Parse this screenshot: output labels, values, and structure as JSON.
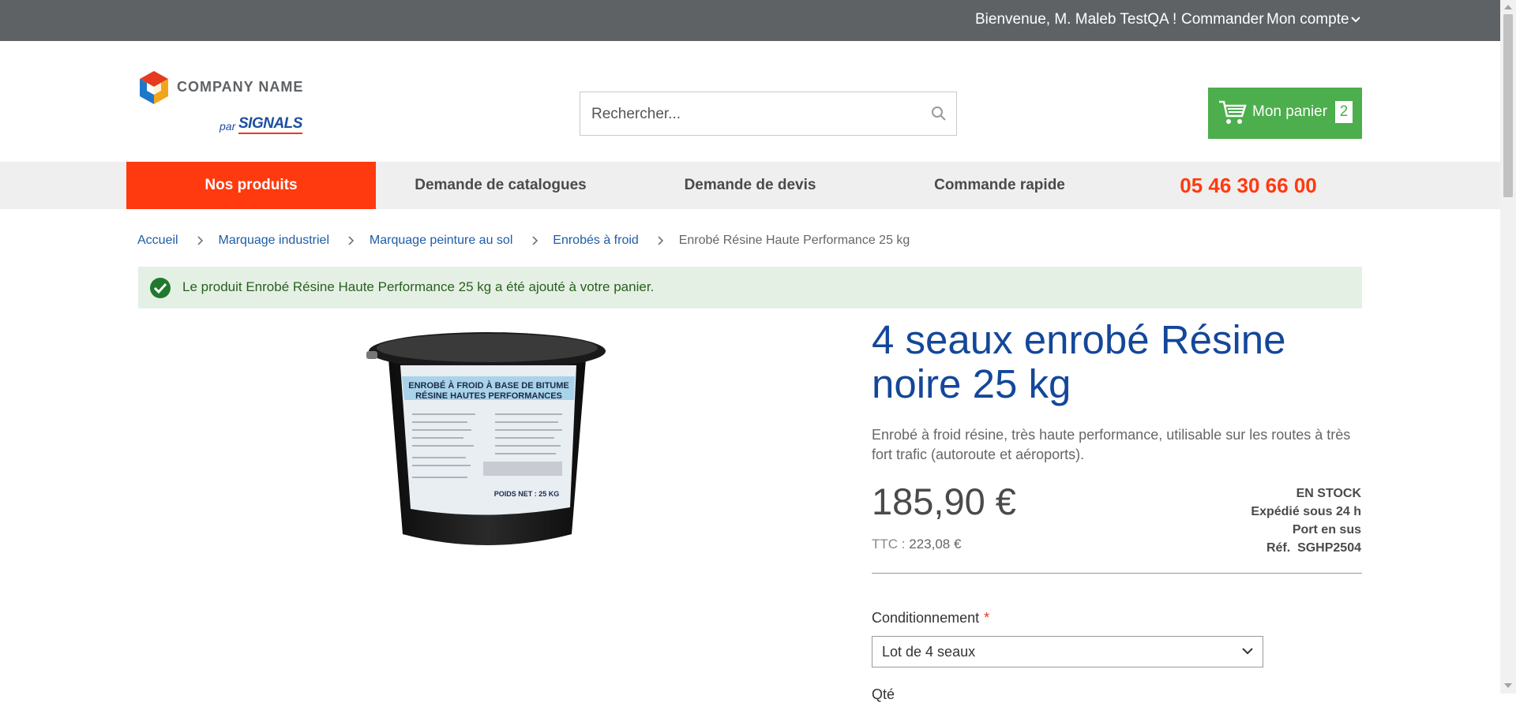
{
  "topbar": {
    "welcome": "Bienvenue, M. Maleb TestQA !",
    "order": "Commander",
    "account": "Mon compte"
  },
  "logo": {
    "brand": "COMPANY NAME",
    "par": "par",
    "signals": "SIGNALS"
  },
  "search": {
    "placeholder": "Rechercher..."
  },
  "cart": {
    "label": "Mon panier",
    "count": "2"
  },
  "nav": {
    "items": [
      {
        "label": "Nos produits"
      },
      {
        "label": "Demande de catalogues"
      },
      {
        "label": "Demande de devis"
      },
      {
        "label": "Commande rapide"
      }
    ],
    "phone": "05 46 30 66 00"
  },
  "breadcrumb": [
    "Accueil",
    "Marquage industriel",
    "Marquage peinture au sol",
    "Enrobés à froid",
    "Enrobé Résine Haute Performance 25 kg"
  ],
  "alert": {
    "message": "Le produit Enrobé Résine Haute Performance 25 kg a été ajouté à votre panier."
  },
  "product": {
    "title": "4 seaux enrobé Résine noire 25 kg",
    "description": "Enrobé à froid résine, très haute performance, utilisable sur les routes à très fort trafic (autoroute et aéroports).",
    "price": "185,90 €",
    "ttc_label": "TTC :",
    "ttc_value": "223,08 €",
    "stock": "EN STOCK",
    "shipping": "Expédié sous 24 h",
    "port": "Port en sus",
    "ref_label": "Réf.",
    "ref_value": "SGHP2504",
    "bucket_label": {
      "line1": "ENROBÉ À FROID À BASE DE BITUME",
      "line2": "RÉSINE HAUTES PERFORMANCES",
      "weight": "POIDS NET : 25 KG"
    }
  },
  "options": {
    "conditionnement_label": "Conditionnement",
    "required_mark": "*",
    "conditionnement_value": "Lot de 4 seaux",
    "qty_label": "Qté"
  },
  "colors": {
    "topbar": "#5f6265",
    "accent_orange": "#ff3a0f",
    "cart_green": "#4cae4c",
    "title_blue": "#13479a",
    "link_blue": "#1e5ca8",
    "alert_bg": "#e5f0e4"
  }
}
